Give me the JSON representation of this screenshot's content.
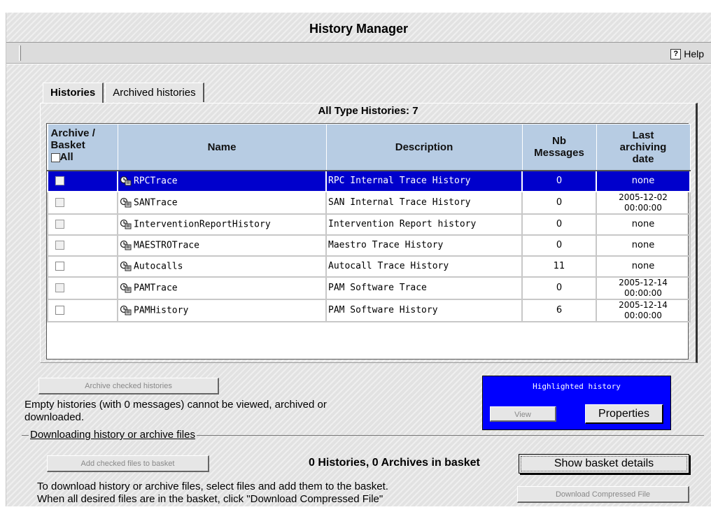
{
  "window": {
    "title": "History Manager"
  },
  "toolbar": {
    "help_label": "Help",
    "help_icon": "?"
  },
  "tabs": [
    {
      "label": "Histories",
      "active": true
    },
    {
      "label": "Archived histories",
      "active": false
    }
  ],
  "histories": {
    "box_title": "All Type Histories: 7",
    "columns": {
      "archive_line1": "Archive /",
      "archive_line2": "Basket",
      "all_label": "All",
      "name": "Name",
      "description": "Description",
      "nb_line1": "Nb",
      "nb_line2": "Messages",
      "last_line1": "Last",
      "last_line2": "archiving",
      "last_line3": "date"
    },
    "rows": [
      {
        "name": "RPCTrace",
        "description": "RPC Internal Trace History",
        "nb": "0",
        "date1": "none",
        "date2": "",
        "selected": true,
        "checkable": false
      },
      {
        "name": "SANTrace",
        "description": "SAN Internal Trace History",
        "nb": "0",
        "date1": "2005-12-02",
        "date2": "00:00:00",
        "selected": false,
        "checkable": false
      },
      {
        "name": "InterventionReportHistory",
        "description": "Intervention Report history",
        "nb": "0",
        "date1": "none",
        "date2": "",
        "selected": false,
        "checkable": false
      },
      {
        "name": "MAESTROTrace",
        "description": "Maestro Trace History",
        "nb": "0",
        "date1": "none",
        "date2": "",
        "selected": false,
        "checkable": false
      },
      {
        "name": "Autocalls",
        "description": "Autocall Trace History",
        "nb": "11",
        "date1": "none",
        "date2": "",
        "selected": false,
        "checkable": true
      },
      {
        "name": "PAMTrace",
        "description": "PAM Software Trace",
        "nb": "0",
        "date1": "2005-12-14",
        "date2": "00:00:00",
        "selected": false,
        "checkable": false
      },
      {
        "name": "PAMHistory",
        "description": "PAM Software History",
        "nb": "6",
        "date1": "2005-12-14",
        "date2": "00:00:00",
        "selected": false,
        "checkable": true
      }
    ],
    "archive_button": "Archive checked histories",
    "empty_note_line1": "Empty histories (with 0 messages) cannot be viewed, archived or",
    "empty_note_line2": "downloaded."
  },
  "highlighted": {
    "title": "Highlighted history",
    "view_button": "View",
    "properties_button": "Properties"
  },
  "download": {
    "legend": "Downloading history or archive files",
    "add_button": "Add checked files to basket",
    "basket_count": "0 Histories, 0 Archives in basket",
    "show_basket_button": "Show basket details",
    "note_line1": "To download history or archive files, select files and add them to the basket.",
    "note_line2": "When all desired files are in the basket, click \"Download Compressed File\"",
    "download_button": "Download Compressed File"
  },
  "colors": {
    "header_bg": "#b7cce3",
    "selected_row": "#0000cc",
    "highlight_panel": "#0000ff"
  }
}
